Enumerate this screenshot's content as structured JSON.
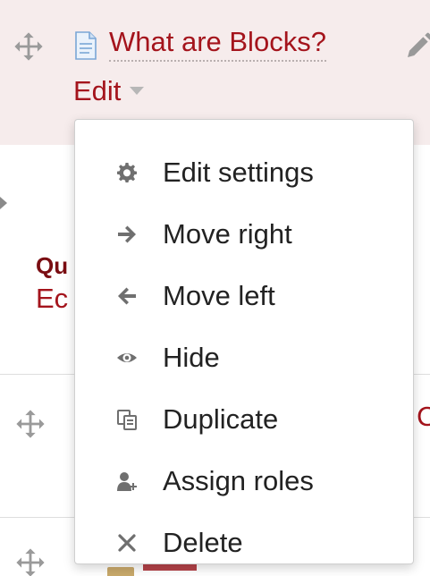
{
  "activity": {
    "title": "What are Blocks?",
    "edit_label": "Edit",
    "icon": "page-icon"
  },
  "background": {
    "section_title": "Qu",
    "section_edit": "Ec",
    "right_letter": "C"
  },
  "menu": {
    "items": [
      {
        "label": "Edit settings",
        "icon": "gear-icon"
      },
      {
        "label": "Move right",
        "icon": "arrow-right-icon"
      },
      {
        "label": "Move left",
        "icon": "arrow-left-icon"
      },
      {
        "label": "Hide",
        "icon": "eye-icon"
      },
      {
        "label": "Duplicate",
        "icon": "duplicate-icon"
      },
      {
        "label": "Assign roles",
        "icon": "assign-roles-icon"
      },
      {
        "label": "Delete",
        "icon": "delete-icon"
      }
    ]
  },
  "colors": {
    "link": "#a4141c",
    "row_highlight": "#f6ecec",
    "icon_gray": "#6f6f6f",
    "menu_text": "#222222"
  }
}
